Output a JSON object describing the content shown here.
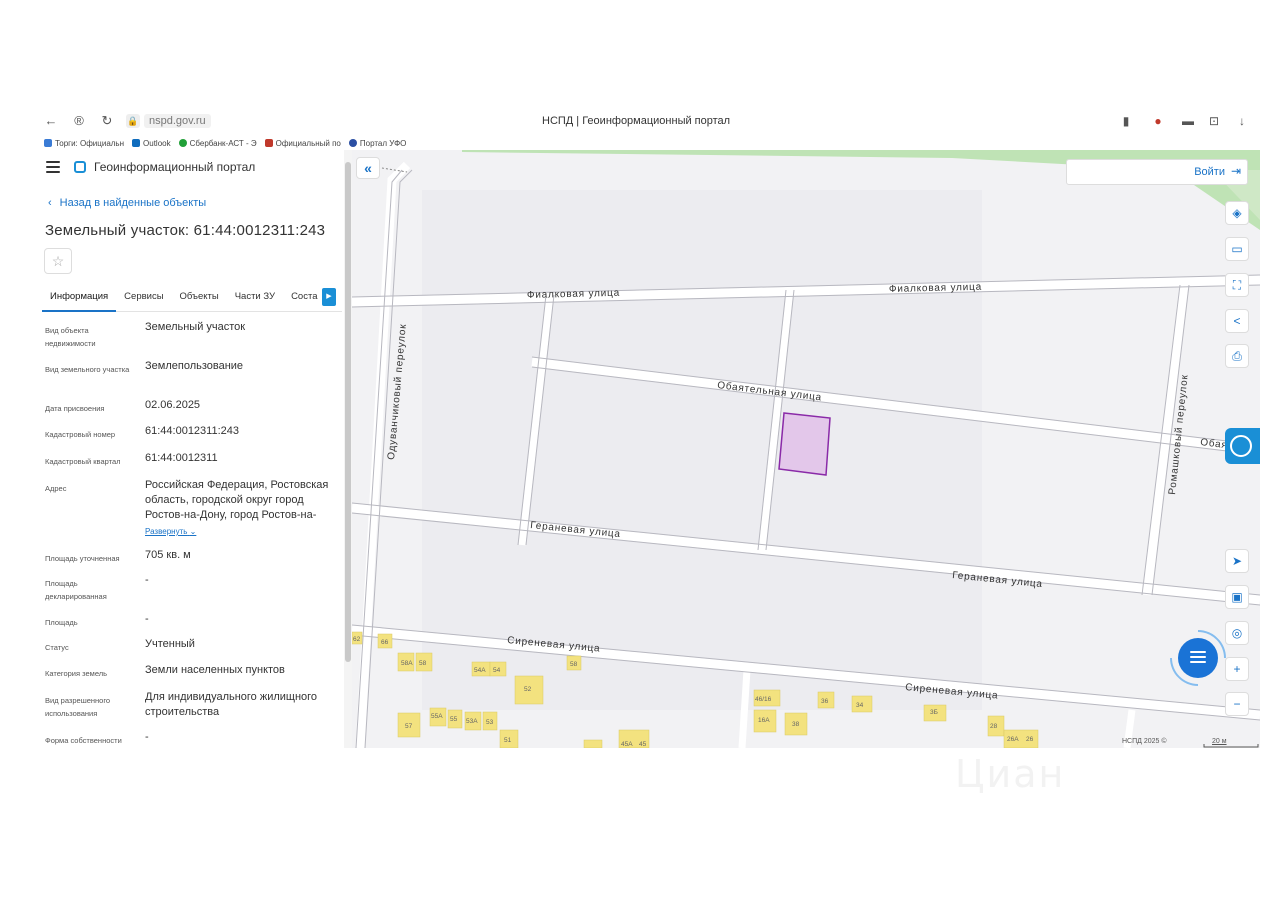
{
  "browser": {
    "url": "nspd.gov.ru",
    "title": "НСПД | Геоинформационный портал",
    "bookmarks": [
      {
        "label": "Торги: Официальн",
        "color": "#3a7bd5"
      },
      {
        "label": "Outlook",
        "color": "#0f6cbd"
      },
      {
        "label": "Сбербанк-АСТ - Э",
        "color": "#21a038"
      },
      {
        "label": "Официальный по",
        "color": "#c0392b"
      },
      {
        "label": "Портал УФО",
        "color": "#2b4fa3"
      }
    ]
  },
  "panel": {
    "portal_name": "Геоинформационный портал",
    "back_label": "Назад в найденные объекты",
    "title": "Земельный участок: 61:44:0012311:243",
    "tabs": [
      "Информация",
      "Сервисы",
      "Объекты",
      "Части ЗУ",
      "Соста"
    ],
    "properties": [
      {
        "key": "Вид объекта недвижимости",
        "value": "Земельный участок"
      },
      {
        "key": "Вид земельного участка",
        "value": "Землепользование"
      },
      {
        "key": "Дата присвоения",
        "value": "02.06.2025"
      },
      {
        "key": "Кадастровый номер",
        "value": "61:44:0012311:243"
      },
      {
        "key": "Кадастровый квартал",
        "value": "61:44:0012311"
      },
      {
        "key": "Адрес",
        "value": "Российская Федерация, Ростовская область, городской округ город Ростов-на-Дону, город Ростов-на-",
        "extra": "Развернуть"
      },
      {
        "key": "Площадь уточненная",
        "value": "705 кв. м"
      },
      {
        "key": "Площадь декларированная",
        "value": "-"
      },
      {
        "key": "Площадь",
        "value": "-"
      },
      {
        "key": "Статус",
        "value": "Учтенный"
      },
      {
        "key": "Категория земель",
        "value": "Земли населенных пунктов"
      },
      {
        "key": "Вид разрешенного использования",
        "value": "Для индивидуального жилищного строительства"
      },
      {
        "key": "Форма собственности",
        "value": "-"
      }
    ]
  },
  "map": {
    "login_label": "Войти",
    "streets": {
      "fialkovaya": "Фиалковая улица",
      "obayatelnaya": "Обаятельная улица",
      "obayatelnaya_short": "Обаятель",
      "geranevaya": "Гераневая улица",
      "sirenevaya": "Сиреневая улица",
      "oduvanchikoviy": "Одуванчиковый переулок",
      "romashkoviy": "Ромашковый переулок"
    },
    "house_numbers": [
      "58А",
      "58",
      "54А",
      "54",
      "58",
      "52",
      "57",
      "55А",
      "55",
      "53А",
      "53",
      "51",
      "45А",
      "45",
      "46/16",
      "36",
      "34",
      "3Б",
      "16А",
      "38",
      "28",
      "26А",
      "26",
      "62",
      "66"
    ],
    "copyright": "НСПД 2025 ©",
    "scale": "20 м",
    "parcel_fill": "#e3c7ea",
    "parcel_stroke": "#8a2aa8",
    "accent": "#1a73c7"
  },
  "watermark": "Циан"
}
